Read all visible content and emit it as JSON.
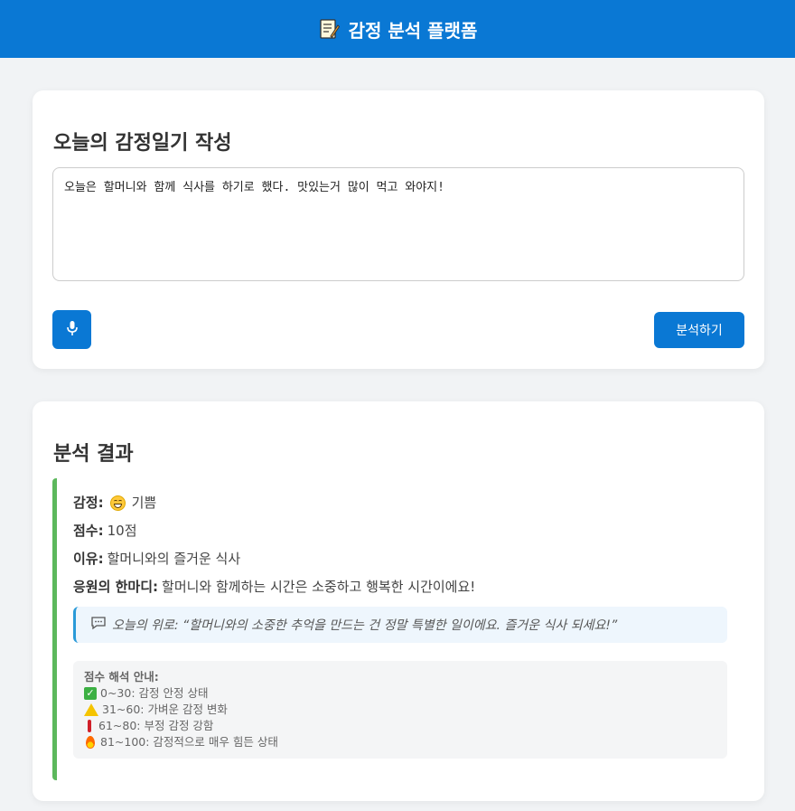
{
  "header": {
    "icon": "memo-icon",
    "title": "감정 분석 플랫폼",
    "color": "#0a78d4"
  },
  "diary_card": {
    "title": "오늘의 감정일기 작성",
    "textarea_value": "오늘은 할머니와 함께 식사를 하기로 했다. 맛있는거 많이 먹고 와야지!",
    "mic_icon": "microphone-icon",
    "analyze_label": "분석하기"
  },
  "result_card": {
    "title": "분석 결과",
    "emotion_label": "감정:",
    "emotion_icon": "smile-emoji-icon",
    "emotion_value": "기쁨",
    "score_label": "점수:",
    "score_value": "10점",
    "reason_label": "이유:",
    "reason_value": "할머니와의 즐거운 식사",
    "cheer_label": "응원의 한마디:",
    "cheer_value": "할머니와 함께하는 시간은 소중하고 행복한 시간이에요!",
    "comfort_icon": "speech-bubble-icon",
    "comfort_text": "오늘의 위로: “할머니와의 소중한 추억을 만드는 건 정말 특별한 일이에요. 즐거운 식사 되세요!”",
    "accent_color": "#5cb85c",
    "guide": {
      "title": "점수 해석 안내:",
      "items": [
        {
          "icon": "check-icon",
          "text": "0~30: 감정 안정 상태"
        },
        {
          "icon": "warning-icon",
          "text": "31~60: 가벼운 감정 변화"
        },
        {
          "icon": "exclamation-icon",
          "text": "61~80: 부정 감정 강함"
        },
        {
          "icon": "fire-icon",
          "text": "81~100: 감정적으로 매우 힘든 상태"
        }
      ]
    }
  }
}
